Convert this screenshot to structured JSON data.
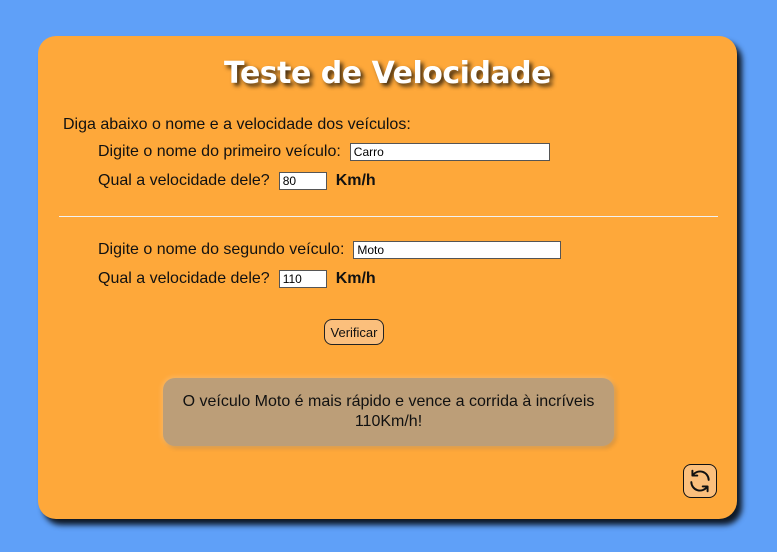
{
  "header": {
    "title": "Teste de Velocidade"
  },
  "form": {
    "intro": "Diga abaixo o nome e a velocidade dos veículos:",
    "vehicle1": {
      "name_label": "Digite o nome do primeiro veículo:",
      "name_value": "Carro",
      "speed_label": "Qual a velocidade dele?",
      "speed_value": "80",
      "unit": "Km/h"
    },
    "vehicle2": {
      "name_label": "Digite o nome do segundo veículo:",
      "name_value": "Moto",
      "speed_label": "Qual a velocidade dele?",
      "speed_value": "110",
      "unit": "Km/h"
    },
    "verify_label": "Verificar"
  },
  "result": {
    "text": "O veículo Moto é mais rápido e vence a corrida à incríveis 110Km/h!"
  },
  "reset": {
    "icon": "refresh-icon"
  },
  "colors": {
    "background": "#5fa0f8",
    "card": "#fea83a",
    "button": "#fbbf7c",
    "result_box": "#bc9e78"
  }
}
